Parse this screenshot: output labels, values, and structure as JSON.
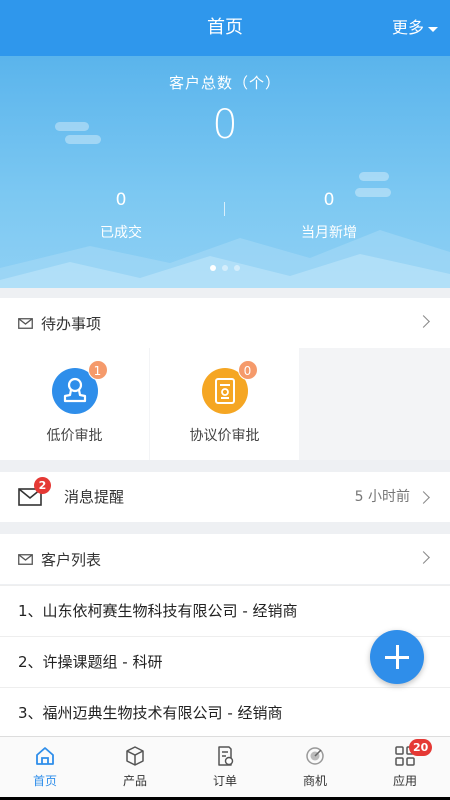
{
  "header": {
    "title": "首页",
    "more_label": "更多"
  },
  "banner": {
    "total_label": "客户总数（个）",
    "total_value": "0",
    "stats": [
      {
        "value": "0",
        "label": "已成交"
      },
      {
        "value": "0",
        "label": "当月新增"
      }
    ],
    "pager_active": 1,
    "pager_count": 3
  },
  "todo": {
    "title": "待办事项",
    "items": [
      {
        "label": "低价审批",
        "badge": "1",
        "color": "#2f8eea",
        "icon": "stamp-icon"
      },
      {
        "label": "协议价审批",
        "badge": "0",
        "color": "#f5a623",
        "icon": "document-icon"
      }
    ]
  },
  "message": {
    "label": "消息提醒",
    "badge": "2",
    "time": "5 小时前"
  },
  "customers": {
    "title": "客户列表",
    "rows": [
      "1、山东依柯赛生物科技有限公司 - 经销商",
      "2、许操课题组 - 科研",
      "3、福州迈典生物技术有限公司 - 经销商"
    ]
  },
  "tabbar": {
    "tabs": [
      {
        "label": "首页",
        "icon": "home-icon",
        "active": true
      },
      {
        "label": "产品",
        "icon": "box-icon"
      },
      {
        "label": "订单",
        "icon": "order-icon"
      },
      {
        "label": "商机",
        "icon": "opportunity-icon"
      },
      {
        "label": "应用",
        "icon": "apps-icon",
        "badge": "20"
      }
    ]
  },
  "colors": {
    "primary": "#2f97ec",
    "badge_red": "#e53935",
    "badge_orange": "#f59a6b"
  }
}
